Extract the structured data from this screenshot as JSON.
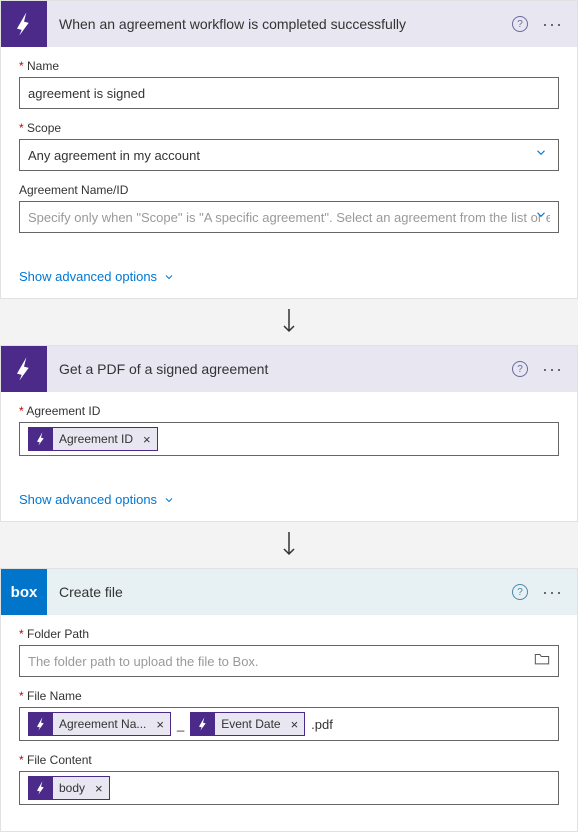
{
  "card1": {
    "title": "When an agreement workflow is completed successfully",
    "name_label": "Name",
    "name_value": "agreement is signed",
    "scope_label": "Scope",
    "scope_value": "Any agreement in my account",
    "agreement_label": "Agreement Name/ID",
    "agreement_placeholder": "Specify only when \"Scope\" is \"A specific agreement\". Select an agreement from the list or en",
    "advanced": "Show advanced options"
  },
  "card2": {
    "title": "Get a PDF of a signed agreement",
    "agreement_id_label": "Agreement ID",
    "token_agreement_id": "Agreement ID",
    "advanced": "Show advanced options"
  },
  "card3": {
    "title": "Create file",
    "box_logo": "box",
    "folder_label": "Folder Path",
    "folder_placeholder": "The folder path to upload the file to Box.",
    "filename_label": "File Name",
    "token_agreement_name": "Agreement Na...",
    "frag_underscore": "_",
    "token_event_date": "Event Date",
    "frag_ext": ".pdf",
    "filecontent_label": "File Content",
    "token_body": "body"
  }
}
